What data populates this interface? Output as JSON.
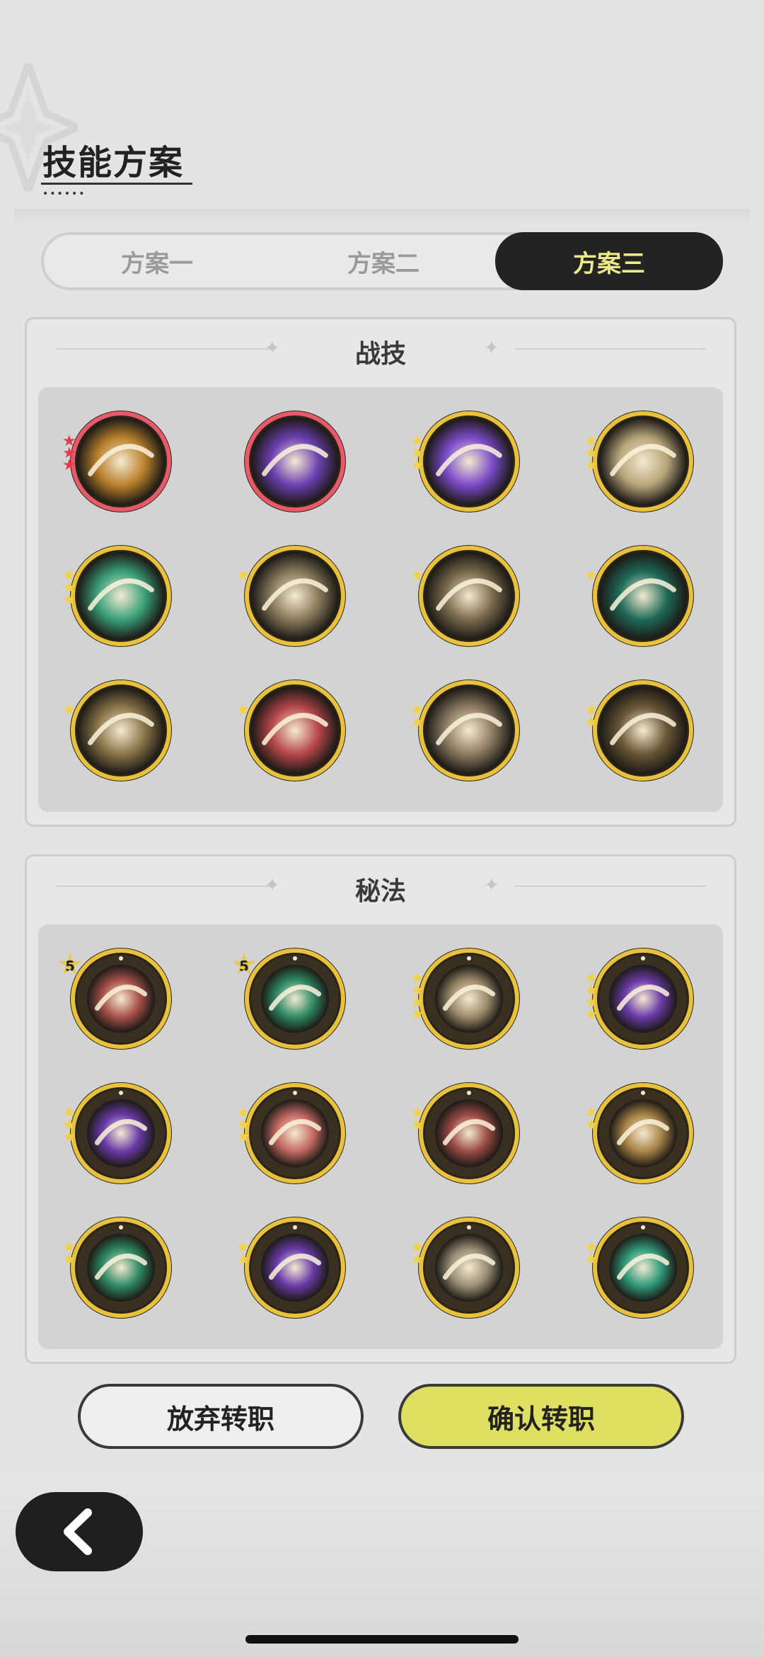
{
  "header": {
    "title": "技能方案"
  },
  "tabs": [
    {
      "label": "方案一",
      "active": false
    },
    {
      "label": "方案二",
      "active": false
    },
    {
      "label": "方案三",
      "active": true
    }
  ],
  "combat_section": {
    "title": "战技",
    "skills": [
      {
        "icon": "golden-slash-skill-icon",
        "stars": 3,
        "star_color": "#e23b4e",
        "ring": "#e85a6a",
        "inner": "#b9802c"
      },
      {
        "icon": "purple-claw-skill-icon",
        "stars": 0,
        "ring": "#e85a6a",
        "inner": "#6b3fb0"
      },
      {
        "icon": "purple-comet-skill-icon",
        "stars": 3,
        "star_color": "#f2d14a",
        "ring": "#e8c23c",
        "inner": "#7a4ac8"
      },
      {
        "icon": "grasping-hand-skill-icon",
        "stars": 3,
        "star_color": "#f2d14a",
        "ring": "#e8c23c",
        "inner": "#b8a57a"
      },
      {
        "icon": "green-arrows-up-skill-icon",
        "stars": 3,
        "star_color": "#f2d14a",
        "ring": "#e8c23c",
        "inner": "#3aa07a"
      },
      {
        "icon": "wind-slash-skill-icon",
        "stars": 1,
        "star_color": "#f2d14a",
        "ring": "#e8c23c",
        "inner": "#8a7a5c"
      },
      {
        "icon": "whirlwind-skill-icon",
        "stars": 1,
        "star_color": "#f2d14a",
        "ring": "#e8c23c",
        "inner": "#7a6a4c"
      },
      {
        "icon": "green-crescent-skill-icon",
        "stars": 1,
        "star_color": "#f2d14a",
        "ring": "#e8c23c",
        "inner": "#1f6a58"
      },
      {
        "icon": "light-slash-skill-icon",
        "stars": 1,
        "star_color": "#f2d14a",
        "ring": "#e8c23c",
        "inner": "#8a7448"
      },
      {
        "icon": "raised-sword-figure-skill-icon",
        "stars": 1,
        "star_color": "#f2d14a",
        "ring": "#e8c23c",
        "inner": "#b5454a"
      },
      {
        "icon": "charging-figures-skill-icon",
        "stars": 2,
        "star_color": "#f2d14a",
        "ring": "#e8c23c",
        "inner": "#8c7a62"
      },
      {
        "icon": "sword-crescent-skill-icon",
        "stars": 2,
        "star_color": "#f2d14a",
        "ring": "#e8c23c",
        "inner": "#6a5636"
      }
    ]
  },
  "secret_section": {
    "title": "秘法",
    "skills": [
      {
        "icon": "red-strike-secret-icon",
        "level": "5",
        "stars": 0,
        "ring": "#e8c23c",
        "inner": "#a8504a"
      },
      {
        "icon": "green-heal-circle-secret-icon",
        "level": "5",
        "stars": 0,
        "ring": "#e8c23c",
        "inner": "#2f8a66"
      },
      {
        "icon": "leaf-crescent-secret-icon",
        "stars": 4,
        "star_color": "#f2d14a",
        "ring": "#e8c23c",
        "inner": "#9c8a6a"
      },
      {
        "icon": "purple-flame-secret-icon",
        "stars": 4,
        "star_color": "#f2d14a",
        "ring": "#e8c23c",
        "inner": "#6a3aa8"
      },
      {
        "icon": "purple-aura-figure-secret-icon",
        "stars": 3,
        "star_color": "#f2d14a",
        "ring": "#e8c23c",
        "inner": "#6a3aa8"
      },
      {
        "icon": "red-sword-plus-secret-icon",
        "stars": 3,
        "star_color": "#f2d14a",
        "ring": "#e8c23c",
        "inner": "#c26862"
      },
      {
        "icon": "red-armor-secret-icon",
        "stars": 2,
        "star_color": "#f2d14a",
        "ring": "#e8c23c",
        "inner": "#9a4a44"
      },
      {
        "icon": "gold-armor-secret-icon",
        "stars": 2,
        "star_color": "#f2d14a",
        "ring": "#e8c23c",
        "inner": "#a88446"
      },
      {
        "icon": "green-heart-plus-secret-icon",
        "stars": 2,
        "star_color": "#f2d14a",
        "ring": "#e8c23c",
        "inner": "#2f8a66"
      },
      {
        "icon": "purple-beast-secret-icon",
        "stars": 2,
        "star_color": "#f2d14a",
        "ring": "#e8c23c",
        "inner": "#6a3aa8"
      },
      {
        "icon": "sword-arrows-up-secret-icon",
        "stars": 2,
        "star_color": "#f2d14a",
        "ring": "#e8c23c",
        "inner": "#9a8e76"
      },
      {
        "icon": "green-sword-secret-icon",
        "stars": 2,
        "star_color": "#f2d14a",
        "ring": "#e8c23c",
        "inner": "#2f9a7a"
      }
    ]
  },
  "actions": {
    "abandon_label": "放弃转职",
    "confirm_label": "确认转职"
  },
  "nav": {
    "back_icon": "chevron-left-icon"
  }
}
